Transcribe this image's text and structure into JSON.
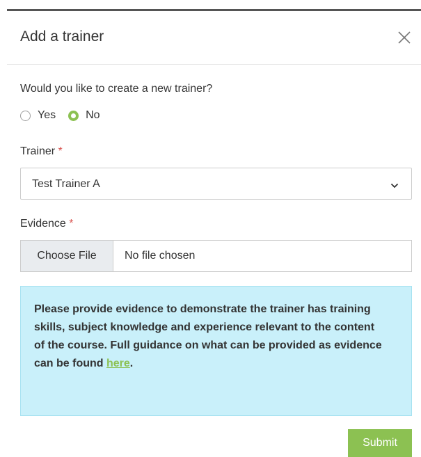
{
  "modal": {
    "title": "Add a trainer",
    "close_icon": "close-icon"
  },
  "create_trainer": {
    "question": "Would you like to create a new trainer?",
    "options": [
      {
        "label": "Yes",
        "selected": false
      },
      {
        "label": "No",
        "selected": true
      }
    ]
  },
  "trainer": {
    "label": "Trainer",
    "required_mark": "*",
    "selected_value": "Test Trainer A",
    "dropdown_icon": "chevron-down-icon"
  },
  "evidence": {
    "label": "Evidence",
    "required_mark": "*",
    "button_label": "Choose File",
    "status": "No file chosen"
  },
  "info": {
    "text": "Please provide evidence to demonstrate the trainer has training skills, subject knowledge and experience relevant to the content of the course. Full guidance on what can be provided as evidence can be found ",
    "link_text": "here",
    "end": "."
  },
  "actions": {
    "submit_label": "Submit"
  },
  "colors": {
    "accent": "#8cc152",
    "info_background": "#c9f0fa",
    "required": "#d9534f"
  }
}
